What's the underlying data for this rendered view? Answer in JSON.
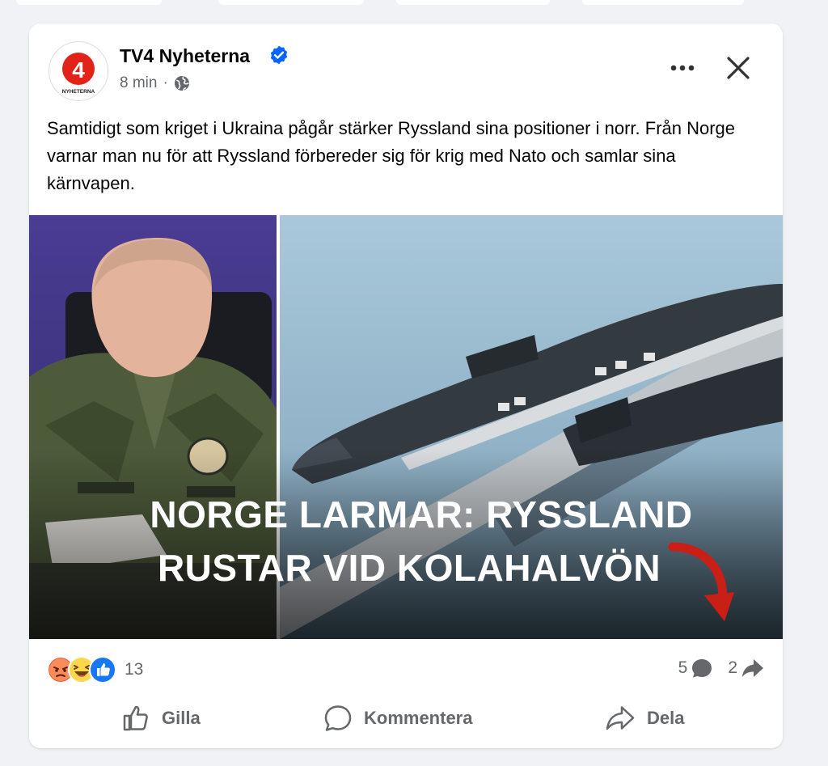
{
  "post": {
    "page_name": "TV4 Nyheterna",
    "timestamp": "8 min",
    "separator": "·",
    "logo_number": "4",
    "logo_caption": "NYHETERNA",
    "text": "Samtidigt som kriget i Ukraina pågår stärker Ryssland sina positioner i norr. Från Norge varnar man nu för att Ryssland förbereder sig för krig med Nato och samlar sina kärnvapen.",
    "image_headline_line1": "NORGE LARMAR: RYSSLAND",
    "image_headline_line2": "RUSTAR VID KOLAHALVÖN"
  },
  "engagement": {
    "reaction_count": "13",
    "reaction_icons": [
      "angry-reaction-icon",
      "haha-reaction-icon",
      "like-reaction-icon"
    ],
    "comment_count": "5",
    "share_count": "2"
  },
  "actions": {
    "like_label": "Gilla",
    "comment_label": "Kommentera",
    "share_label": "Dela"
  },
  "colors": {
    "brand_red": "#e2231a",
    "verified_blue": "#0866ff",
    "secondary_text": "#65676b",
    "arrow_red": "#c91f16"
  }
}
